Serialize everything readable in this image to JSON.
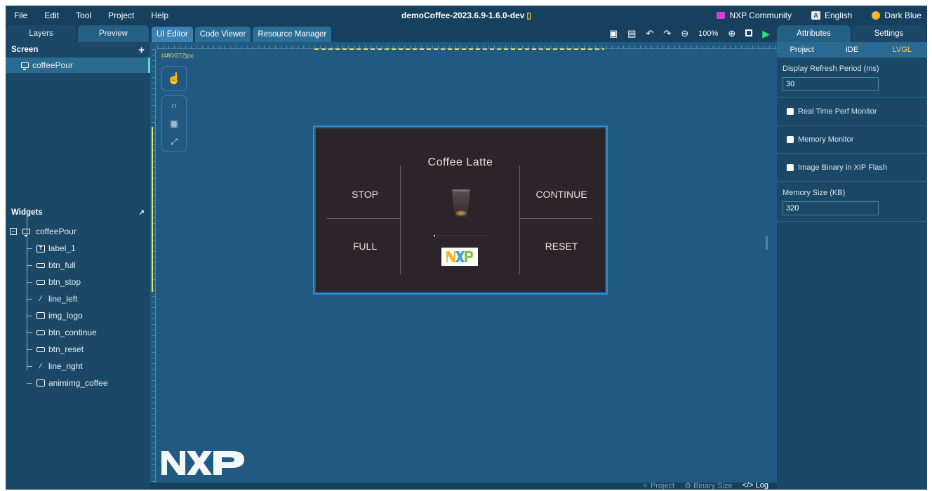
{
  "menubar": {
    "items": [
      "File",
      "Edit",
      "Tool",
      "Project",
      "Help"
    ],
    "title": "demoCoffee-2023.6.9-1.6.0-dev",
    "community": "NXP Community",
    "language": "English",
    "language_icon_text": "A",
    "theme": "Dark Blue"
  },
  "left": {
    "tabs": [
      "Layers",
      "Preview"
    ],
    "screen_header": "Screen",
    "add_icon": "+",
    "screens": [
      "coffeePour"
    ],
    "widgets_header": "Widgets",
    "widget_root": "coffeePour",
    "collapse_symbol": "−",
    "widgets": [
      {
        "name": "label_1",
        "icon": "label-icon"
      },
      {
        "name": "btn_full",
        "icon": "button-icon"
      },
      {
        "name": "btn_stop",
        "icon": "button-icon"
      },
      {
        "name": "line_left",
        "icon": "line-icon"
      },
      {
        "name": "img_logo",
        "icon": "image-icon"
      },
      {
        "name": "btn_continue",
        "icon": "button-icon"
      },
      {
        "name": "btn_reset",
        "icon": "button-icon"
      },
      {
        "name": "line_right",
        "icon": "line-icon"
      },
      {
        "name": "animimg_coffee",
        "icon": "animimg-icon"
      }
    ]
  },
  "center": {
    "tabs": [
      "UI Editor",
      "Code Viewer",
      "Resource Manager"
    ],
    "zoom": "100%",
    "dims": "(480/272)px",
    "device": {
      "title": "Coffee Latte",
      "btn_stop": "STOP",
      "btn_full": "FULL",
      "btn_continue": "CONTINUE",
      "btn_reset": "RESET",
      "logo": "NXP"
    },
    "status": [
      "Project",
      "Binary Size",
      "Log"
    ]
  },
  "right": {
    "tabs": [
      "Attributes",
      "Settings"
    ],
    "subtabs": [
      "Project",
      "IDE",
      "LVGL"
    ],
    "refresh_label": "Display Refresh Period (ms)",
    "refresh_value": "30",
    "checks": [
      "Real Time Perf Monitor",
      "Memory Monitor",
      "Image Binary in XIP Flash"
    ],
    "memory_label": "Memory Size (KB)",
    "memory_value": "320"
  },
  "colors": {
    "accent": "#2d8fd8",
    "active_subtab": "#f2d04f",
    "play": "#2ee07a",
    "background": "#1f5577"
  }
}
